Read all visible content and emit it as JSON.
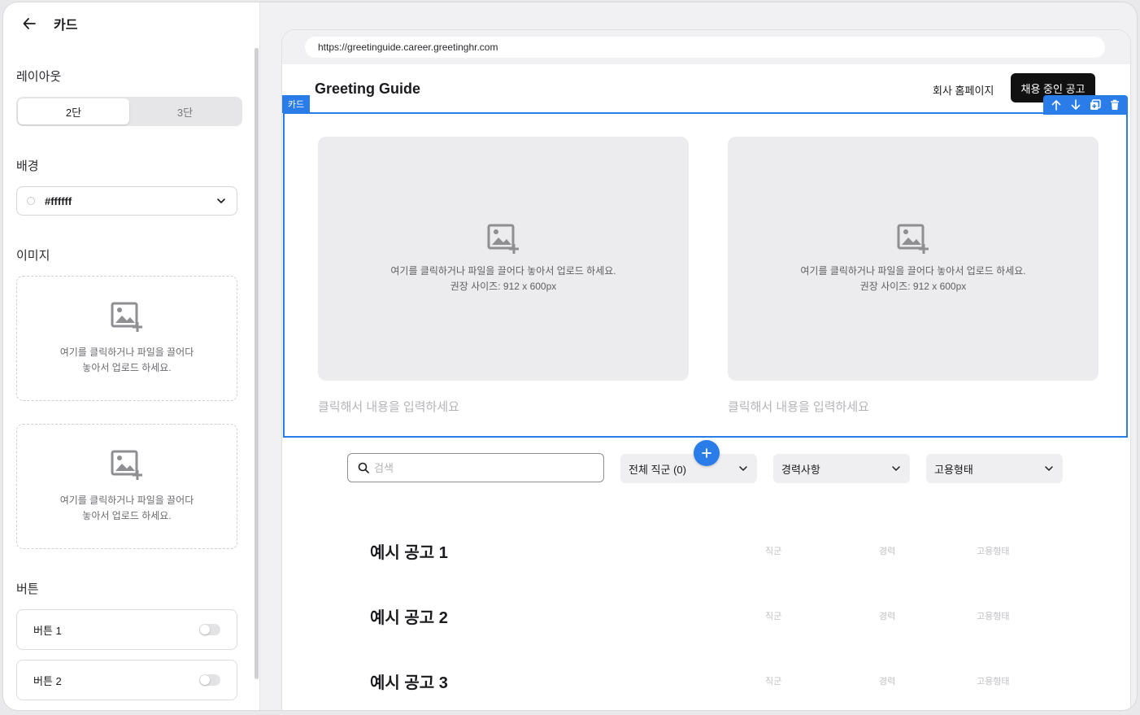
{
  "panel": {
    "title": "카드",
    "layout_label": "레이아웃",
    "layout_options": [
      "2단",
      "3단"
    ],
    "layout_selected": "2단",
    "background_label": "배경",
    "background_value": "#ffffff",
    "image_label": "이미지",
    "upload_text_line1": "여기를 클릭하거나 파일을 끌어다",
    "upload_text_line2": "놓아서 업로드 하세요.",
    "buttons_label": "버튼",
    "buttons": [
      {
        "label": "버튼 1",
        "enabled": false
      },
      {
        "label": "버튼 2",
        "enabled": false
      }
    ]
  },
  "preview": {
    "url": "https://greetinguide.career.greetinghr.com",
    "site_title": "Greeting Guide",
    "nav_link": "회사 홈페이지",
    "nav_cta": "채용 중인 공고",
    "card_tag": "카드",
    "slot_text_line1": "여기를 클릭하거나 파일을 끌어다 놓아서 업로드 하세요.",
    "slot_text_line2": "권장 사이즈: 912 x 600px",
    "card_placeholder": "클릭해서 내용을 입력하세요",
    "search_placeholder": "검색",
    "filters": [
      "전체 직군 (0)",
      "경력사항",
      "고용형태"
    ],
    "jobs": [
      {
        "title": "예시 공고 1",
        "category": "직군",
        "career": "경력",
        "type": "고용형태"
      },
      {
        "title": "예시 공고 2",
        "category": "직군",
        "career": "경력",
        "type": "고용형태"
      },
      {
        "title": "예시 공고 3",
        "category": "직군",
        "career": "경력",
        "type": "고용형태"
      }
    ]
  },
  "colors": {
    "accent": "#2a7de8",
    "cta": "#111111"
  }
}
